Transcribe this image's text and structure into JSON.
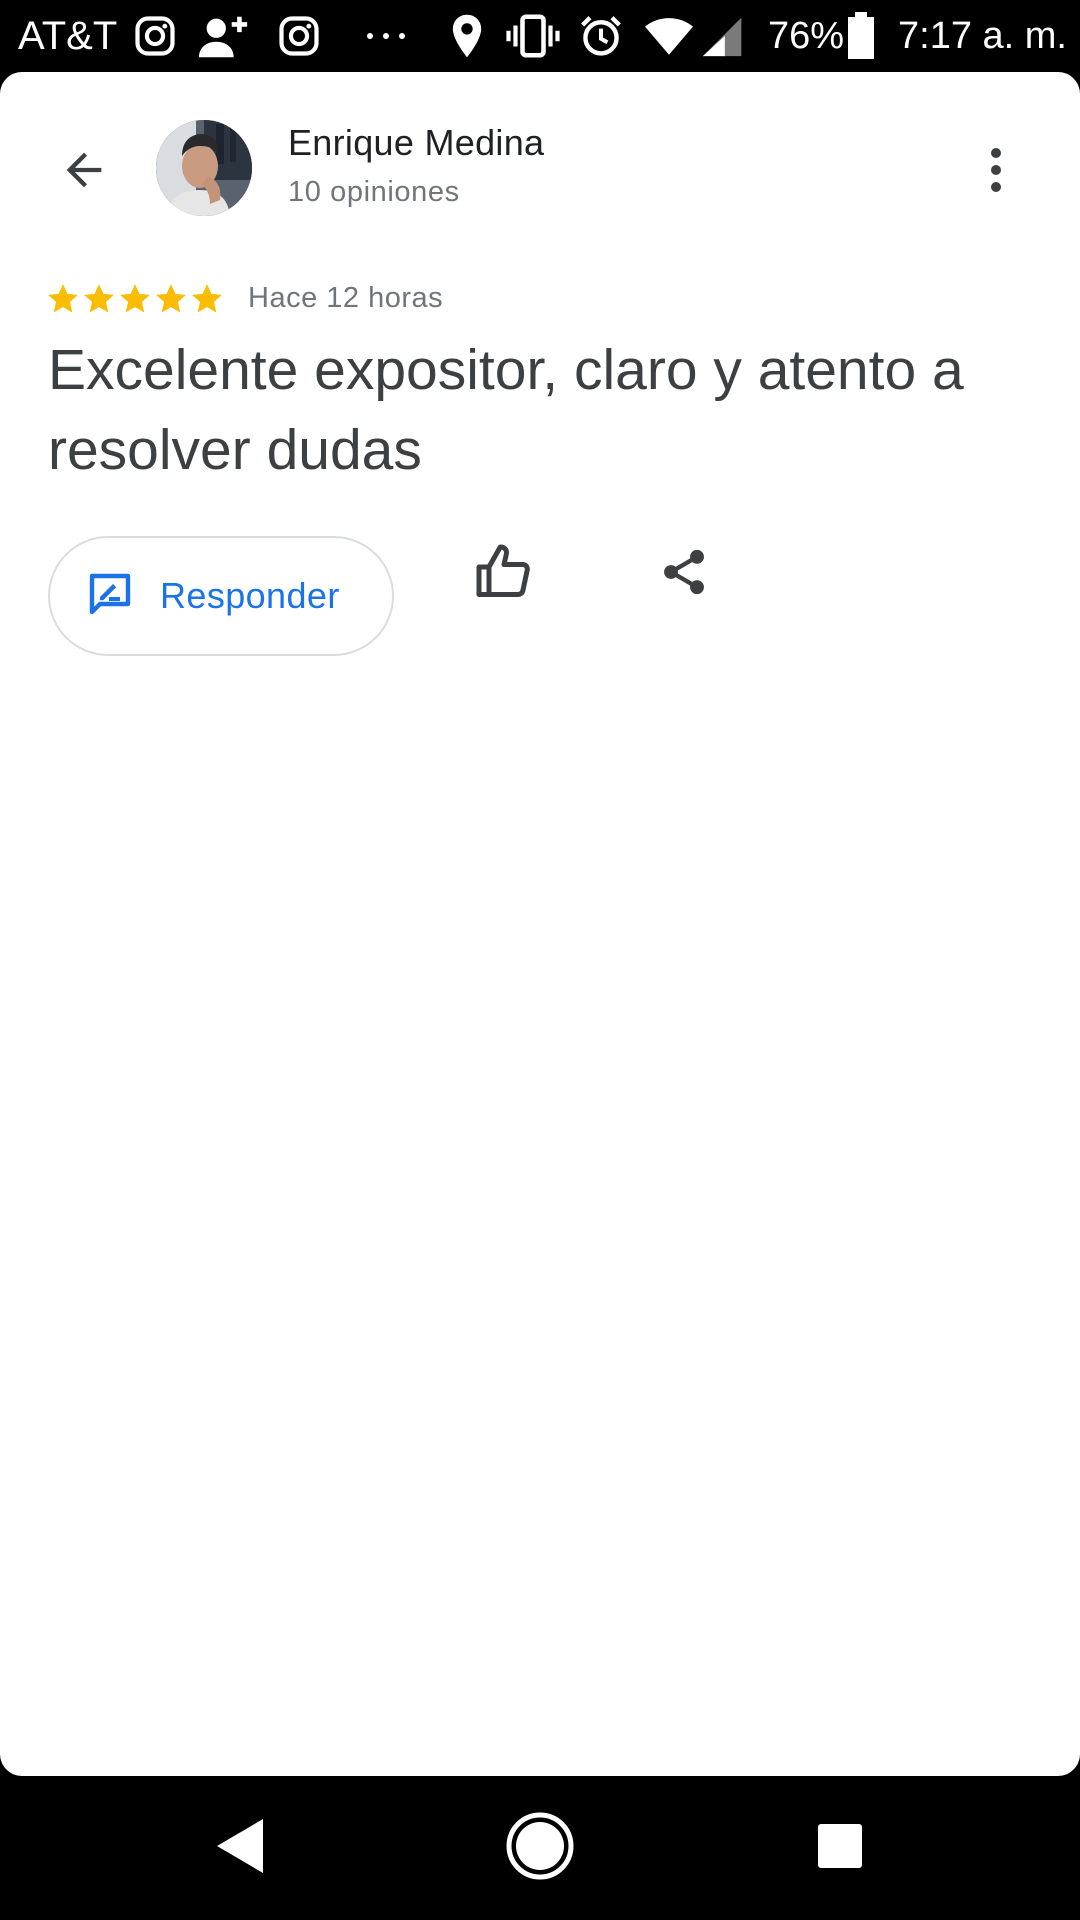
{
  "status_bar": {
    "carrier": "AT&T",
    "battery_percent": "76%",
    "time": "7:17 a. m.",
    "icons": [
      "instagram-icon",
      "person-add-icon",
      "instagram-icon",
      "more-notifications-icon",
      "location-icon",
      "vibrate-icon",
      "alarm-icon",
      "wifi-icon",
      "signal-icon",
      "battery-icon"
    ]
  },
  "header": {
    "author_name": "Enrique Medina",
    "review_count": "10 opiniones",
    "back_icon": "arrow-back-icon",
    "more_icon": "more-vert-icon"
  },
  "review": {
    "rating": 5,
    "rating_max": 5,
    "time": "Hace 12 horas",
    "text": "Excelente expositor, claro y atento a resolver dudas",
    "star_color": "#fbbc04"
  },
  "actions": {
    "reply_label": "Responder",
    "reply_icon": "rate-review-icon",
    "like_icon": "thumb-up-icon",
    "share_icon": "share-icon",
    "accent_color": "#1a73e8"
  },
  "nav_bar": {
    "icons": [
      "nav-back-icon",
      "nav-home-icon",
      "nav-recents-icon"
    ]
  }
}
